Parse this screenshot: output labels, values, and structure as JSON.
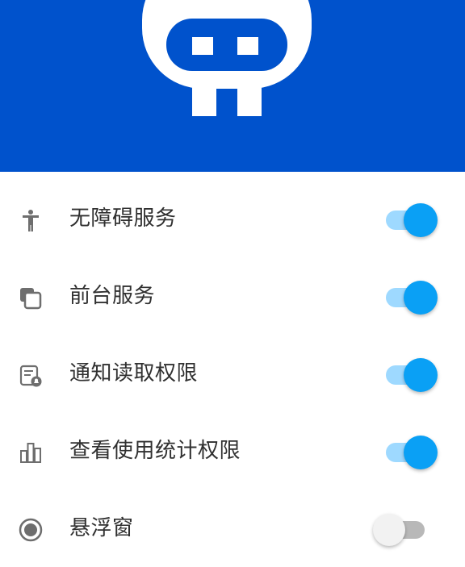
{
  "colors": {
    "header_bg": "#0052CC",
    "logo_fg": "#FFFFFF",
    "toggle_on_thumb": "#0AA0F5",
    "toggle_on_track": "#9ED9FF",
    "toggle_off_thumb": "#F2F2F2",
    "toggle_off_track": "#B8B8B8",
    "icon_gray": "#6E6E6E",
    "label_text": "#303030"
  },
  "header": {
    "logo_icon": "robot-face-logo-icon"
  },
  "permissions": [
    {
      "label": "无障碍服务",
      "icon": "accessibility-icon",
      "enabled": true
    },
    {
      "label": "前台服务",
      "icon": "copy-layers-icon",
      "enabled": true
    },
    {
      "label": "通知读取权限",
      "icon": "notification-doc-icon",
      "enabled": true
    },
    {
      "label": "查看使用统计权限",
      "icon": "bar-chart-icon",
      "enabled": true
    },
    {
      "label": "悬浮窗",
      "icon": "radio-target-icon",
      "enabled": false
    }
  ]
}
